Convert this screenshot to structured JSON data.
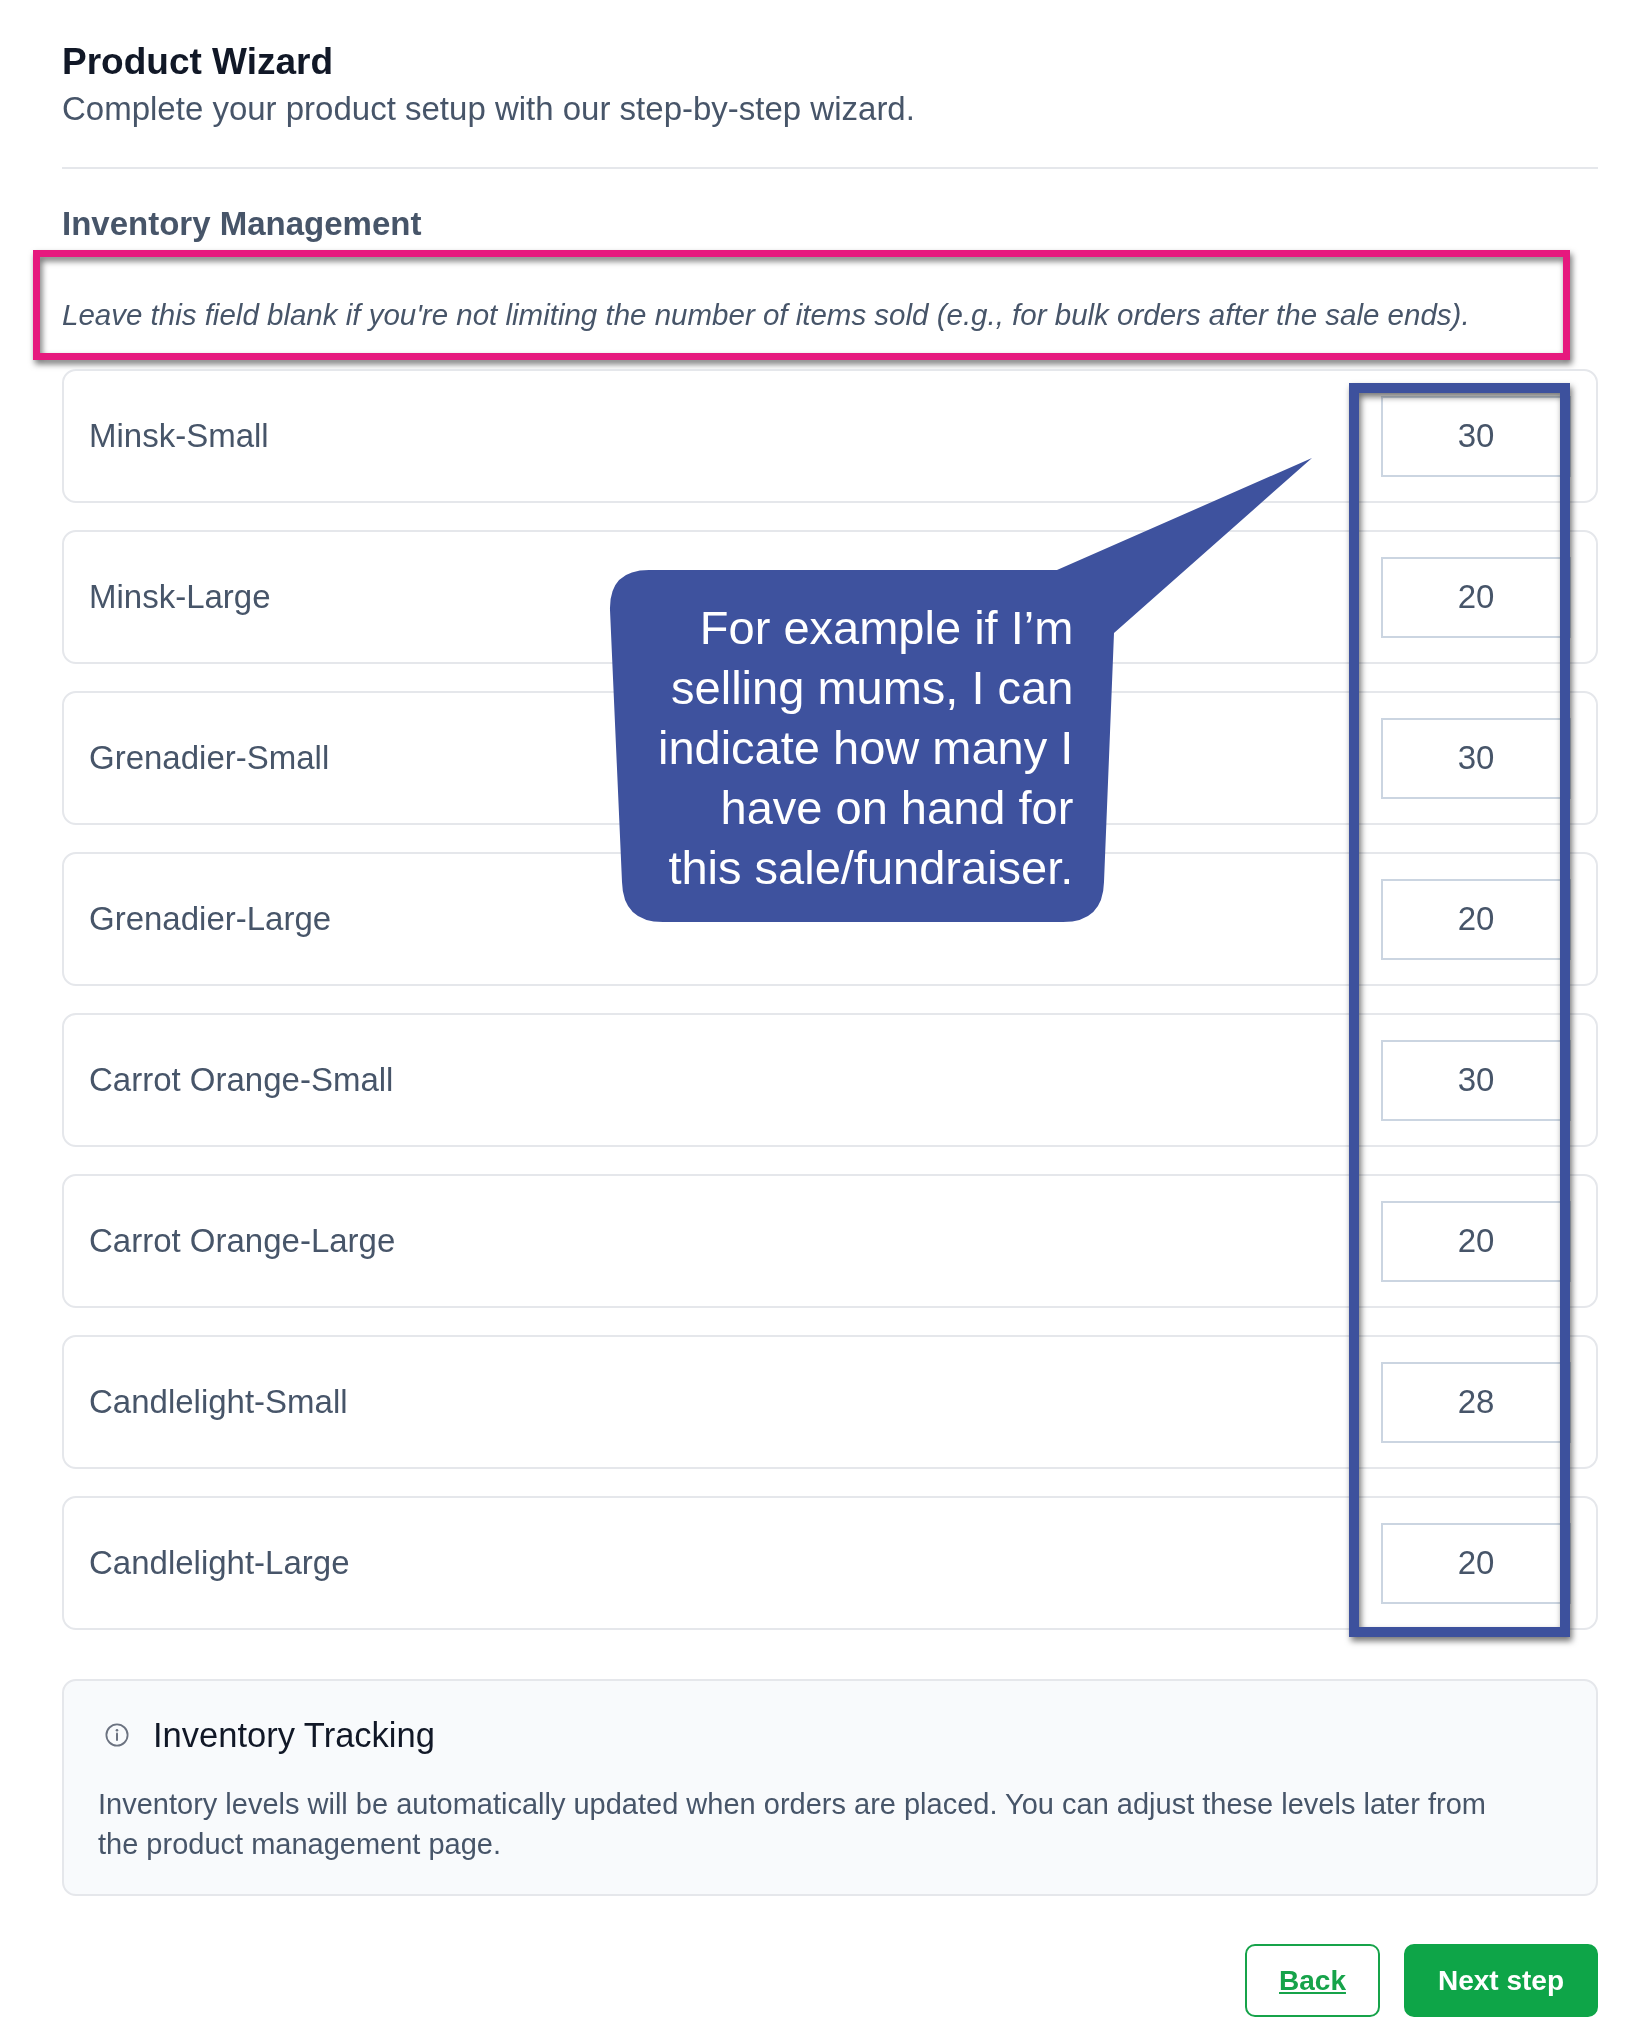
{
  "header": {
    "title": "Product Wizard",
    "subtitle": "Complete your product setup with our step-by-step wizard."
  },
  "section": {
    "title": "Inventory Management",
    "hint": "Leave this field blank if you're not limiting the number of items sold (e.g., for bulk orders after the sale ends).",
    "hint_highlighted": true,
    "quantities_highlighted": true,
    "variants": [
      {
        "name": "Minsk-Small",
        "quantity": "30"
      },
      {
        "name": "Minsk-Large",
        "quantity": "20"
      },
      {
        "name": "Grenadier-Small",
        "quantity": "30"
      },
      {
        "name": "Grenadier-Large",
        "quantity": "20"
      },
      {
        "name": "Carrot Orange-Small",
        "quantity": "30"
      },
      {
        "name": "Carrot Orange-Large",
        "quantity": "20"
      },
      {
        "name": "Candlelight-Small",
        "quantity": "28"
      },
      {
        "name": "Candlelight-Large",
        "quantity": "20"
      }
    ]
  },
  "callout": {
    "text": "For example if I’m selling mums, I can indicate how many I have on hand for this sale/fundraiser."
  },
  "info": {
    "title": "Inventory Tracking",
    "text": "Inventory levels will be automatically updated when orders are placed. You can adjust these levels later from the product management page."
  },
  "buttons": [
    {
      "label": "Back",
      "kind": "secondary"
    },
    {
      "label": "Next step",
      "kind": "primary"
    }
  ]
}
